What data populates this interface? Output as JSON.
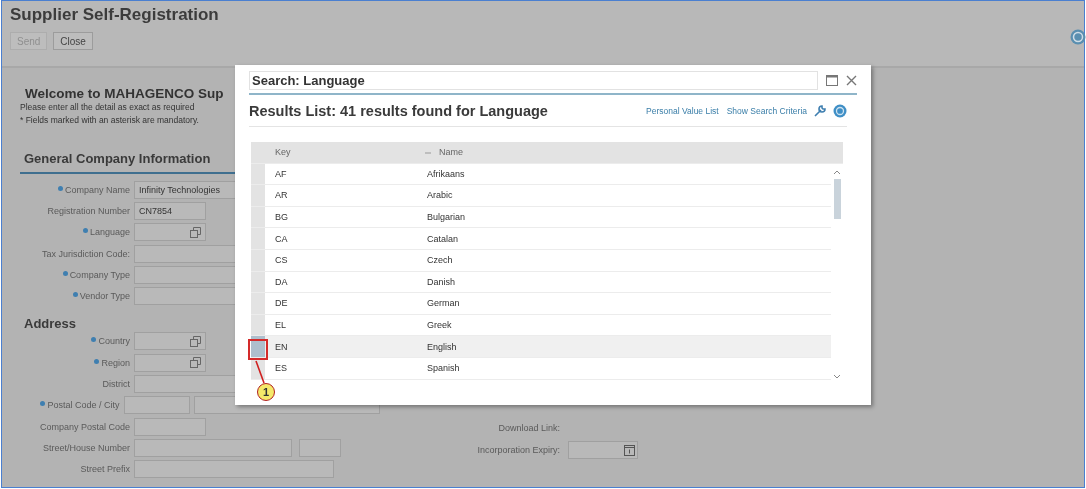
{
  "window": {
    "title": "Supplier Self-Registration"
  },
  "toolbar": [
    {
      "label": "Send",
      "disabled": true
    },
    {
      "label": "Close",
      "disabled": false
    }
  ],
  "form": {
    "heading": "Welcome to MAHAGENCO Sup",
    "notes": [
      "Please enter all the detail as exact as required",
      "* Fields marked with an asterisk are mandatory."
    ],
    "sections": [
      {
        "title": "General Company Information",
        "underline": true,
        "fields": [
          {
            "label": "Company Name",
            "required": true,
            "inputs": [
              {
                "kind": "text",
                "value": "Infinity Technologies"
              }
            ]
          },
          {
            "label": "Registration Number",
            "required": false,
            "inputs": [
              {
                "kind": "short",
                "value": "CN7854"
              }
            ]
          },
          {
            "label": "Language",
            "required": true,
            "inputs": [
              {
                "kind": "lookup"
              }
            ]
          },
          {
            "label": "Tax Jurisdiction Code:",
            "required": false,
            "inputs": [
              {
                "kind": "text"
              }
            ]
          },
          {
            "label": "Company Type",
            "required": true,
            "inputs": [
              {
                "kind": "text"
              }
            ]
          },
          {
            "label": "Vendor Type",
            "required": true,
            "inputs": [
              {
                "kind": "text"
              }
            ]
          }
        ]
      },
      {
        "title": "Address",
        "underline": false,
        "fields": [
          {
            "label": "Country",
            "required": true,
            "inputs": [
              {
                "kind": "lookup"
              }
            ]
          },
          {
            "label": "Region",
            "required": true,
            "inputs": [
              {
                "kind": "lookup"
              }
            ]
          },
          {
            "label": "District",
            "required": false,
            "inputs": [
              {
                "kind": "text"
              }
            ]
          },
          {
            "label": "Postal Code / City",
            "required": true,
            "inputs": [
              {
                "kind": "short"
              },
              {
                "kind": "text"
              }
            ]
          },
          {
            "label": "Company Postal Code",
            "required": false,
            "inputs": [
              {
                "kind": "short"
              }
            ]
          },
          {
            "label": "Street/House Number",
            "required": false,
            "inputs": [
              {
                "kind": "long"
              },
              {
                "kind": "tiny"
              }
            ]
          },
          {
            "label": "Street Prefix",
            "required": false,
            "inputs": [
              {
                "kind": "prefix"
              }
            ]
          }
        ]
      }
    ],
    "side_fields": [
      {
        "label": "Download Link:",
        "kind": "none"
      },
      {
        "label": "Incorporation Expiry:",
        "kind": "date"
      }
    ]
  },
  "dialog": {
    "title": "Search: Language",
    "results_title": "Results List: 41 results found for Language",
    "links": [
      "Personal Value List",
      "Show Search Criteria"
    ],
    "table": {
      "columns": [
        "Key",
        "Name"
      ],
      "rows": [
        {
          "key": "AF",
          "name": "Afrikaans",
          "selected": false
        },
        {
          "key": "AR",
          "name": "Arabic",
          "selected": false
        },
        {
          "key": "BG",
          "name": "Bulgarian",
          "selected": false
        },
        {
          "key": "CA",
          "name": "Catalan",
          "selected": false
        },
        {
          "key": "CS",
          "name": "Czech",
          "selected": false
        },
        {
          "key": "DA",
          "name": "Danish",
          "selected": false
        },
        {
          "key": "DE",
          "name": "German",
          "selected": false
        },
        {
          "key": "EL",
          "name": "Greek",
          "selected": false
        },
        {
          "key": "EN",
          "name": "English",
          "selected": true
        },
        {
          "key": "ES",
          "name": "Spanish",
          "selected": false
        }
      ]
    }
  },
  "callout": {
    "number": "1"
  }
}
